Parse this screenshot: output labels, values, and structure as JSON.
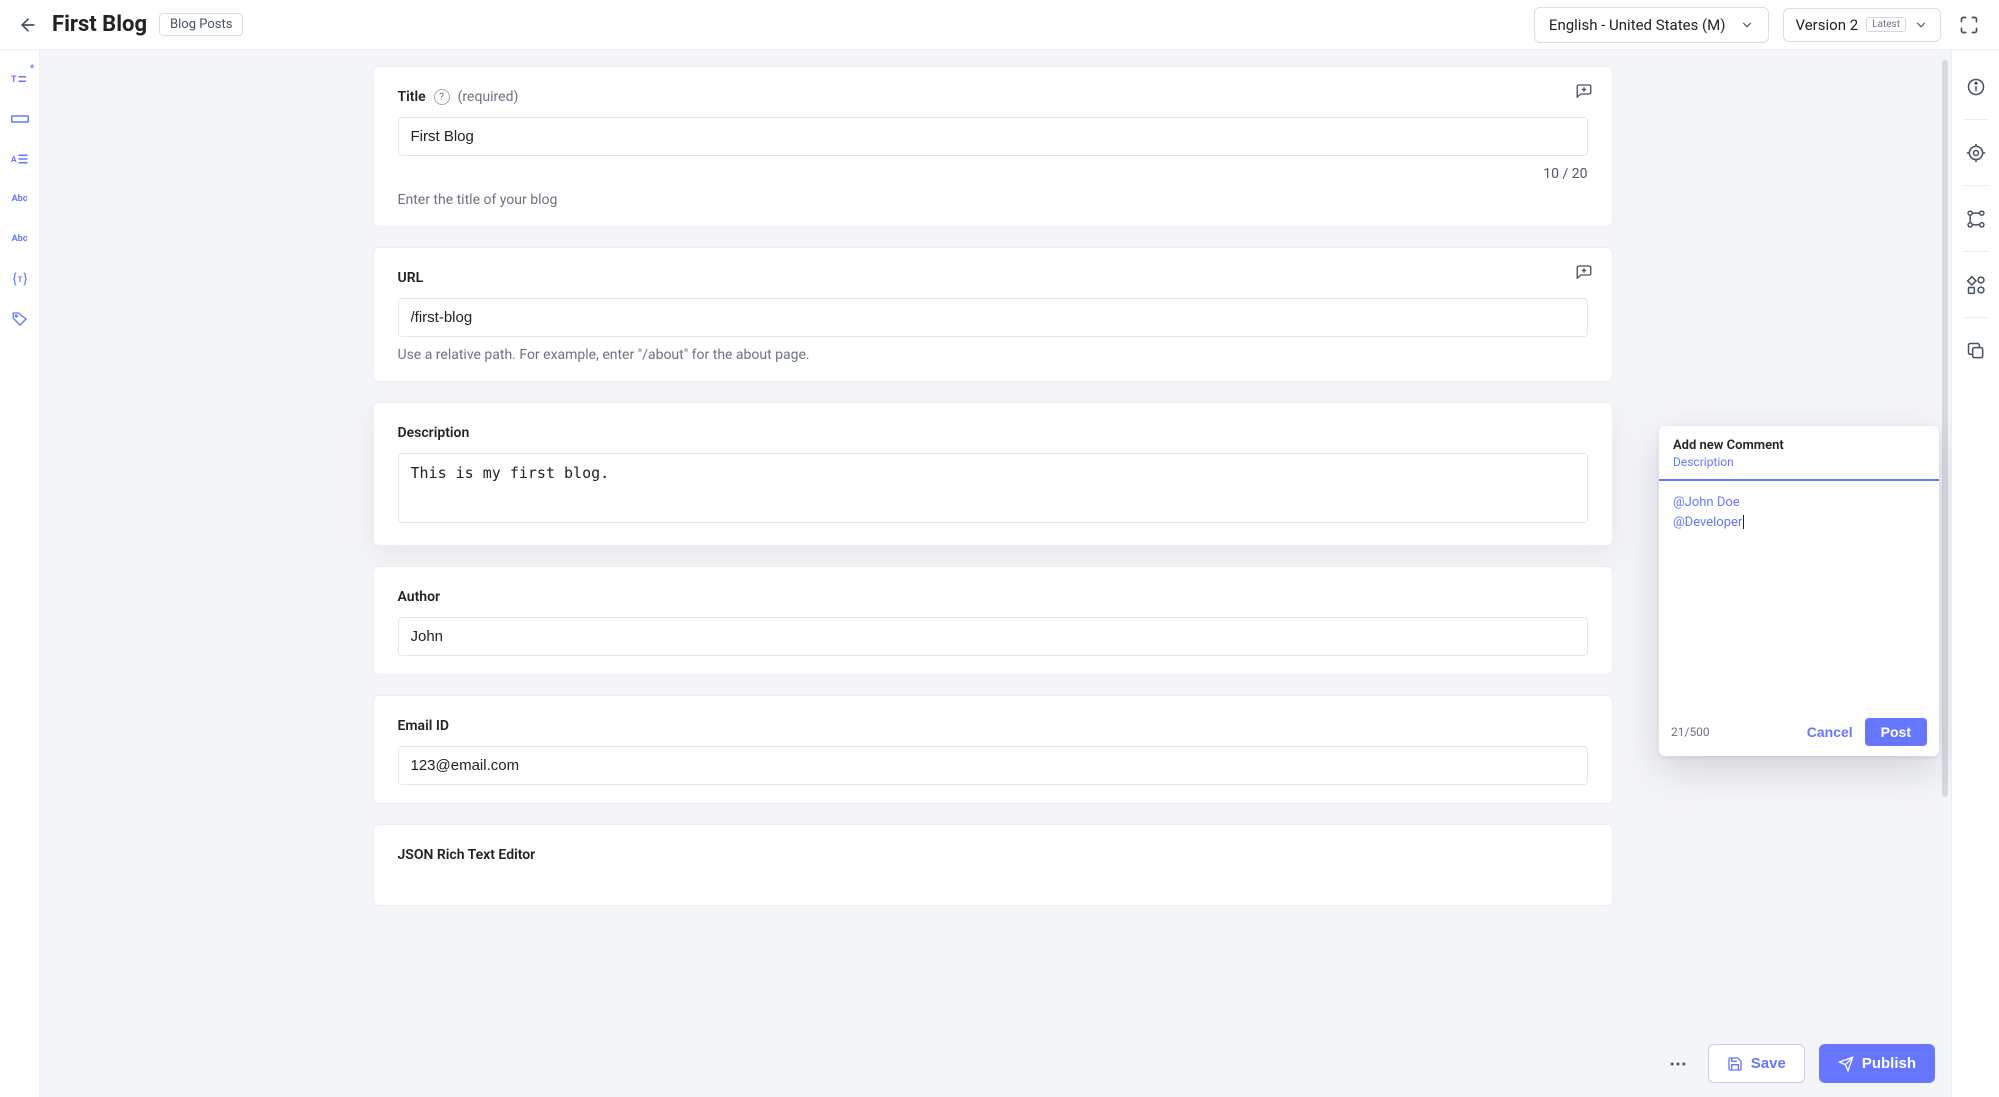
{
  "header": {
    "title": "First Blog",
    "chip": "Blog Posts",
    "locale": "English - United States (M)",
    "version_label": "Version 2",
    "latest_badge": "Latest"
  },
  "fields": {
    "title": {
      "label": "Title",
      "required": "(required)",
      "value": "First Blog",
      "counter": "10 / 20",
      "helper": "Enter the title of your blog"
    },
    "url": {
      "label": "URL",
      "value": "/first-blog",
      "helper": "Use a relative path. For example, enter \"/about\" for the about page."
    },
    "description": {
      "label": "Description",
      "value": "This is my first blog."
    },
    "author": {
      "label": "Author",
      "value": "John"
    },
    "email": {
      "label": "Email ID",
      "value": "123@email.com"
    },
    "json_rte": {
      "label": "JSON Rich Text Editor"
    }
  },
  "comment_popover": {
    "title": "Add new Comment",
    "sub": "Description",
    "mention1": "@John Doe",
    "mention2": "@Developer",
    "counter": "21/500",
    "cancel": "Cancel",
    "post": "Post"
  },
  "footer": {
    "save": "Save",
    "publish": "Publish"
  },
  "leftbar_icons": [
    "text-required-icon",
    "single-line-icon",
    "multi-line-icon",
    "abc-icon",
    "abc-alt-icon",
    "template-icon",
    "tag-icon"
  ],
  "rightbar_icons": [
    "info-icon",
    "settings-target-icon",
    "workflow-icon",
    "widgets-icon",
    "copy-icon"
  ]
}
